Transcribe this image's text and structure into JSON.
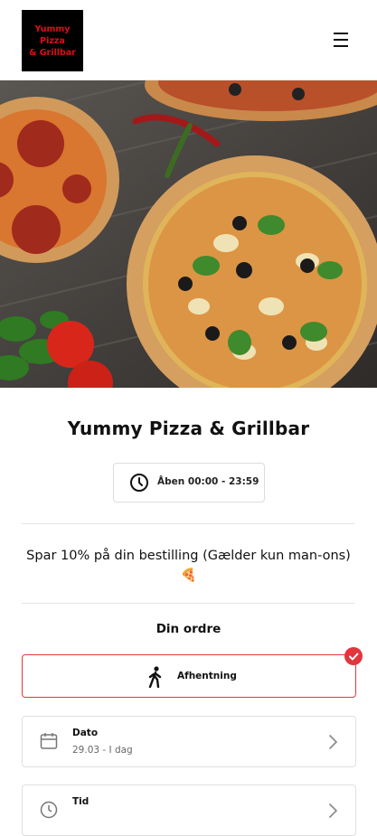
{
  "header": {
    "logo_line1": "Yummy Pizza",
    "logo_line2": "& Grillbar",
    "menu_icon": "hamburger-menu-icon"
  },
  "hero": {
    "description": "pizza-photo"
  },
  "restaurant": {
    "name": "Yummy Pizza & Grillbar",
    "hours": "Åben 00:00 - 23:59"
  },
  "promo": {
    "text": "Spar 10% på din bestilling (Gælder kun man-ons) 🍕"
  },
  "order": {
    "title": "Din ordre",
    "pickup_label": "Afhentning",
    "date_title": "Dato",
    "date_value": "29.03 - I dag",
    "time_title": "Tid"
  },
  "colors": {
    "accent": "#e0363c",
    "logo_text": "#e10c16"
  }
}
